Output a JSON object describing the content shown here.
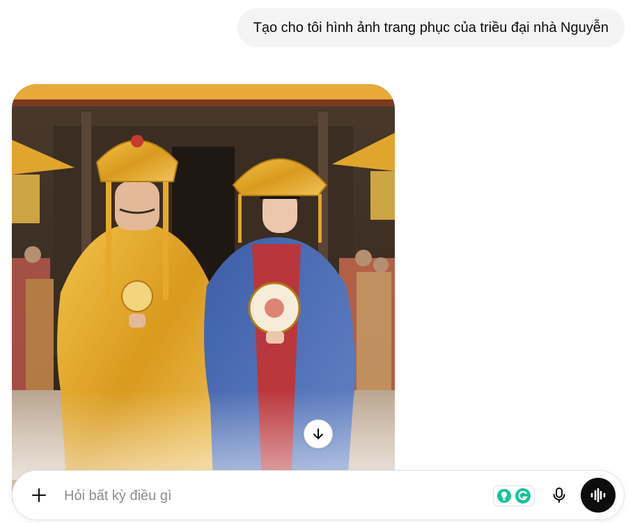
{
  "conversation": {
    "user_message": "Tạo cho tôi hình ảnh trang phục của triều đại nhà Nguyễn"
  },
  "generated_image": {
    "alt": "Trang phục triều đại nhà Nguyễn"
  },
  "composer": {
    "placeholder": "Hỏi bất kỳ điều gì",
    "value": ""
  },
  "icons": {
    "add": "plus-icon",
    "scroll": "arrow-down-icon",
    "extension_1": "lightbulb-icon",
    "extension_2": "grammarly-icon",
    "mic": "microphone-icon",
    "voice": "voice-waveform-icon"
  },
  "colors": {
    "bubble_bg": "#f4f4f4",
    "voice_button_bg": "#0d0d0d",
    "extension_teal": "#15c39a",
    "placeholder": "#8e8e8e"
  }
}
